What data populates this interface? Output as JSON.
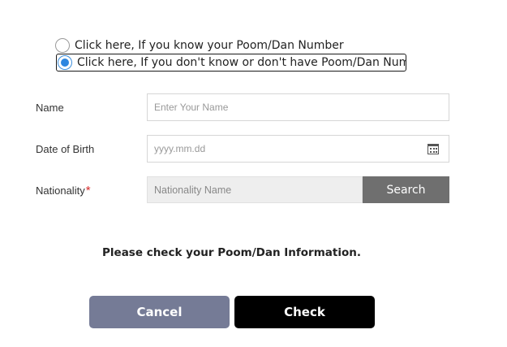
{
  "search_mode": {
    "option_know": {
      "label": "Click here, If you know your Poom/Dan Number",
      "selected": false
    },
    "option_dont_know": {
      "label": "Click here, If you don't know or don't have Poom/Dan Number",
      "selected": true
    }
  },
  "form": {
    "name": {
      "label": "Name",
      "placeholder": "Enter Your Name",
      "value": ""
    },
    "dob": {
      "label": "Date of Birth",
      "placeholder": "yyyy.mm.dd",
      "value": "",
      "icon": "calendar-icon"
    },
    "nationality": {
      "label": "Nationality",
      "required_mark": "*",
      "placeholder": "Nationality Name",
      "value": "",
      "search_label": "Search"
    }
  },
  "message": "Please check your Poom/Dan Information.",
  "actions": {
    "cancel_label": "Cancel",
    "check_label": "Check"
  },
  "colors": {
    "accent": "#2d86e0",
    "required": "#d62b2b",
    "cancel_bg": "#757b96",
    "check_bg": "#000000",
    "search_bg": "#6f6f6f"
  }
}
